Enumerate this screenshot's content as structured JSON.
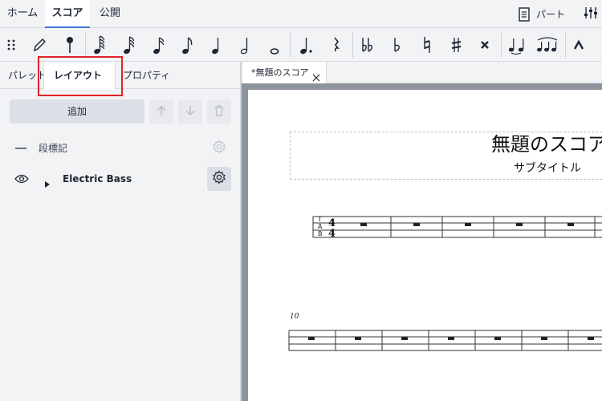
{
  "menu": {
    "tabs": [
      {
        "label": "ホーム"
      },
      {
        "label": "スコア"
      },
      {
        "label": "公開"
      }
    ],
    "parts_label": "パート"
  },
  "toolbar": {
    "icons": [
      "drag-handle-icon",
      "pencil-icon",
      "pin-icon",
      "64th-note-icon",
      "32nd-note-icon",
      "16th-note-icon",
      "eighth-note-icon",
      "quarter-note-icon",
      "half-note-icon",
      "whole-note-icon",
      "dotted-note-icon",
      "rest-icon",
      "double-flat-icon",
      "flat-icon",
      "natural-icon",
      "sharp-icon",
      "double-sharp-icon",
      "tie-icon",
      "slur-icon",
      "marcato-icon"
    ]
  },
  "panel": {
    "tabs": [
      {
        "label": "パレット"
      },
      {
        "label": "レイアウト"
      },
      {
        "label": "プロパティ"
      }
    ],
    "more_label": "···",
    "add_label": "追加",
    "items": [
      {
        "label": "段標記"
      },
      {
        "label": "Electric Bass"
      }
    ]
  },
  "score": {
    "tab_label": "*無題のスコア",
    "title": "無題のスコア",
    "subtitle": "サブタイトル",
    "measure_number": "10",
    "tab_clef": [
      "T",
      "A",
      "B"
    ],
    "time_signature": [
      "4",
      "4"
    ]
  },
  "colors": {
    "accent": "#3a78d6",
    "highlight": "#e3222a",
    "ink": "#1f2533"
  }
}
